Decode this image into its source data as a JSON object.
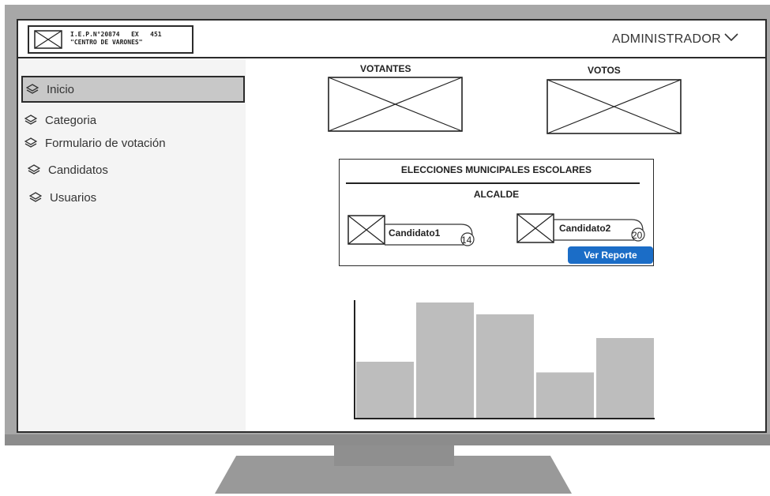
{
  "header": {
    "logo_line1": "I.E.P.N°20874   EX   451",
    "logo_line2": "\"CENTRO DE VARONES\"",
    "user_label": "ADMINISTRADOR"
  },
  "sidebar": {
    "items": [
      {
        "label": "Inicio",
        "active": true
      },
      {
        "label": "Categoria"
      },
      {
        "label": "Formulario de votación"
      },
      {
        "label": "Candidatos"
      },
      {
        "label": "Usuarios"
      }
    ]
  },
  "stats": {
    "voters_label": "VOTANTES",
    "votes_label": "VOTOS"
  },
  "election": {
    "title": "ELECCIONES MUNICIPALES ESCOLARES",
    "position": "ALCALDE",
    "candidates": [
      {
        "name": "Candidato1",
        "votes": "14"
      },
      {
        "name": "Candidato2",
        "votes": "20"
      }
    ],
    "report_button": "Ver Reporte"
  },
  "chart_data": {
    "type": "bar",
    "categories": [
      "",
      "",
      "",
      "",
      ""
    ],
    "values": [
      48,
      98,
      88,
      39,
      68
    ],
    "ylim": [
      0,
      100
    ],
    "title": "",
    "xlabel": "",
    "ylabel": ""
  },
  "colors": {
    "accent": "#1b6dc7",
    "bar": "#bdbdbd",
    "frame": "#a7a7a7"
  }
}
